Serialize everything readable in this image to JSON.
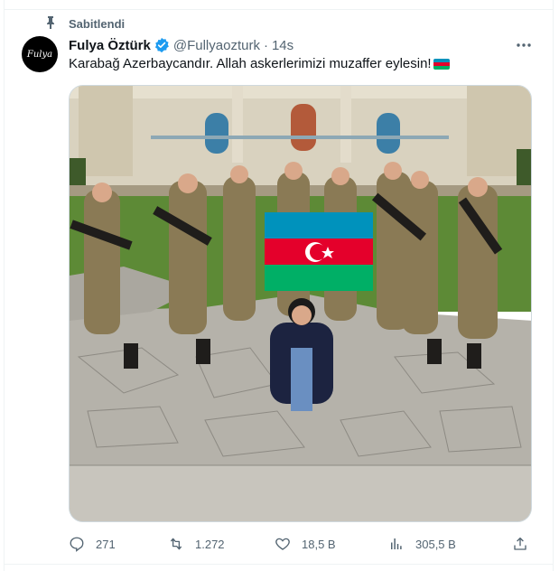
{
  "pinned": {
    "label": "Sabitlendi",
    "icon": "pin-icon"
  },
  "author": {
    "avatar_text": "Fulya",
    "name": "Fulya Öztürk",
    "handle": "@Fullyaozturk",
    "separator": "·",
    "time": "14s",
    "verified_color": "#1d9bf0"
  },
  "tweet": {
    "text": "Karabağ Azerbaycandır. Allah askerlerimizi muzaffer eylesin!",
    "emoji": "azerbaijan-flag"
  },
  "media": {
    "flag_colors": {
      "blue": "#0092bc",
      "red": "#e4002b",
      "green": "#00af66"
    }
  },
  "actions": {
    "replies": "271",
    "reposts": "1.272",
    "likes": "18,5 B",
    "views": "305,5 B"
  },
  "colors": {
    "text": "#0f1419",
    "secondary": "#536471",
    "border": "#eff3f4"
  }
}
